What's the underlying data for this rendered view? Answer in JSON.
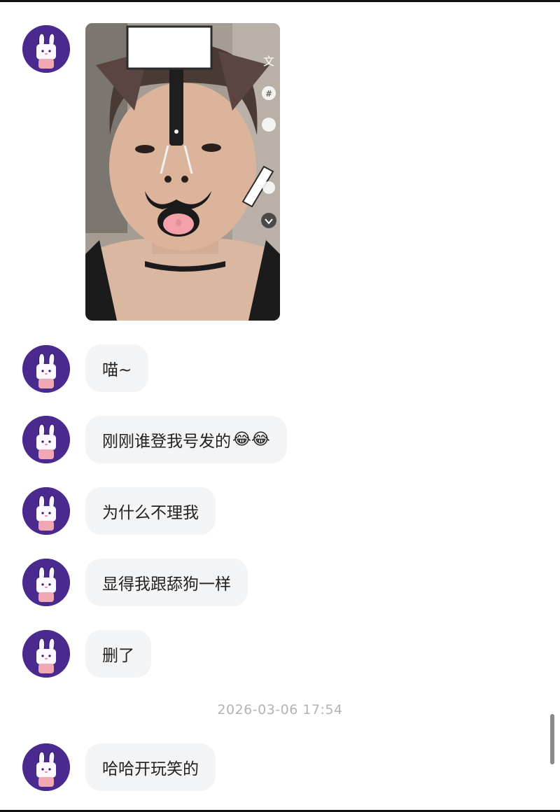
{
  "messages": [
    {
      "type": "image",
      "alt": "photo"
    },
    {
      "type": "text",
      "text": "喵~"
    },
    {
      "type": "text",
      "text": "刚刚谁登我号发的",
      "emoji": "😂😂"
    },
    {
      "type": "text",
      "text": "为什么不理我"
    },
    {
      "type": "text",
      "text": "显得我跟舔狗一样"
    },
    {
      "type": "text",
      "text": "删了"
    },
    {
      "type": "text",
      "text": "哈哈开玩笑的"
    }
  ],
  "timestamp": "2026-03-06 17:54",
  "icons": {
    "avatar": "bunny-avatar-icon",
    "photo_overlay": [
      "translate-icon",
      "hashtag-icon",
      "sticker-icon",
      "tag-icon",
      "chevron-down-icon"
    ],
    "emoji": "tears-of-joy-emoji"
  },
  "colors": {
    "bubble": "#f3f4f6",
    "avatar_bg": "#4b2a8f",
    "timestamp": "#b3b3b3"
  }
}
